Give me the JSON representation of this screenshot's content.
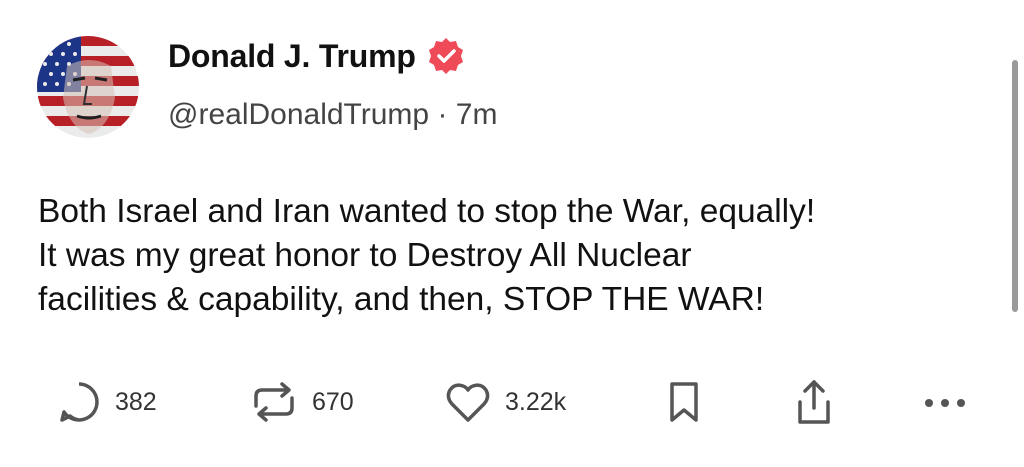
{
  "post": {
    "author": {
      "name": "Donald J. Trump",
      "handle": "@realDonaldTrump",
      "separator": "·",
      "time": "7m",
      "verified_icon": "verified-badge-icon",
      "colors": {
        "verified": "#ee4a57"
      }
    },
    "text_lines": [
      "Both Israel and Iran wanted to stop the War, equally!",
      "It was my great honor to Destroy All Nuclear",
      "facilities & capability, and then, STOP THE WAR!"
    ],
    "actions": {
      "replies": {
        "icon": "reply-icon",
        "count": "382"
      },
      "retruths": {
        "icon": "retruth-icon",
        "count": "670"
      },
      "likes": {
        "icon": "heart-icon",
        "count": "3.22k"
      },
      "bookmark": {
        "icon": "bookmark-icon"
      },
      "share": {
        "icon": "share-icon"
      },
      "more": {
        "icon": "more-icon"
      }
    }
  }
}
